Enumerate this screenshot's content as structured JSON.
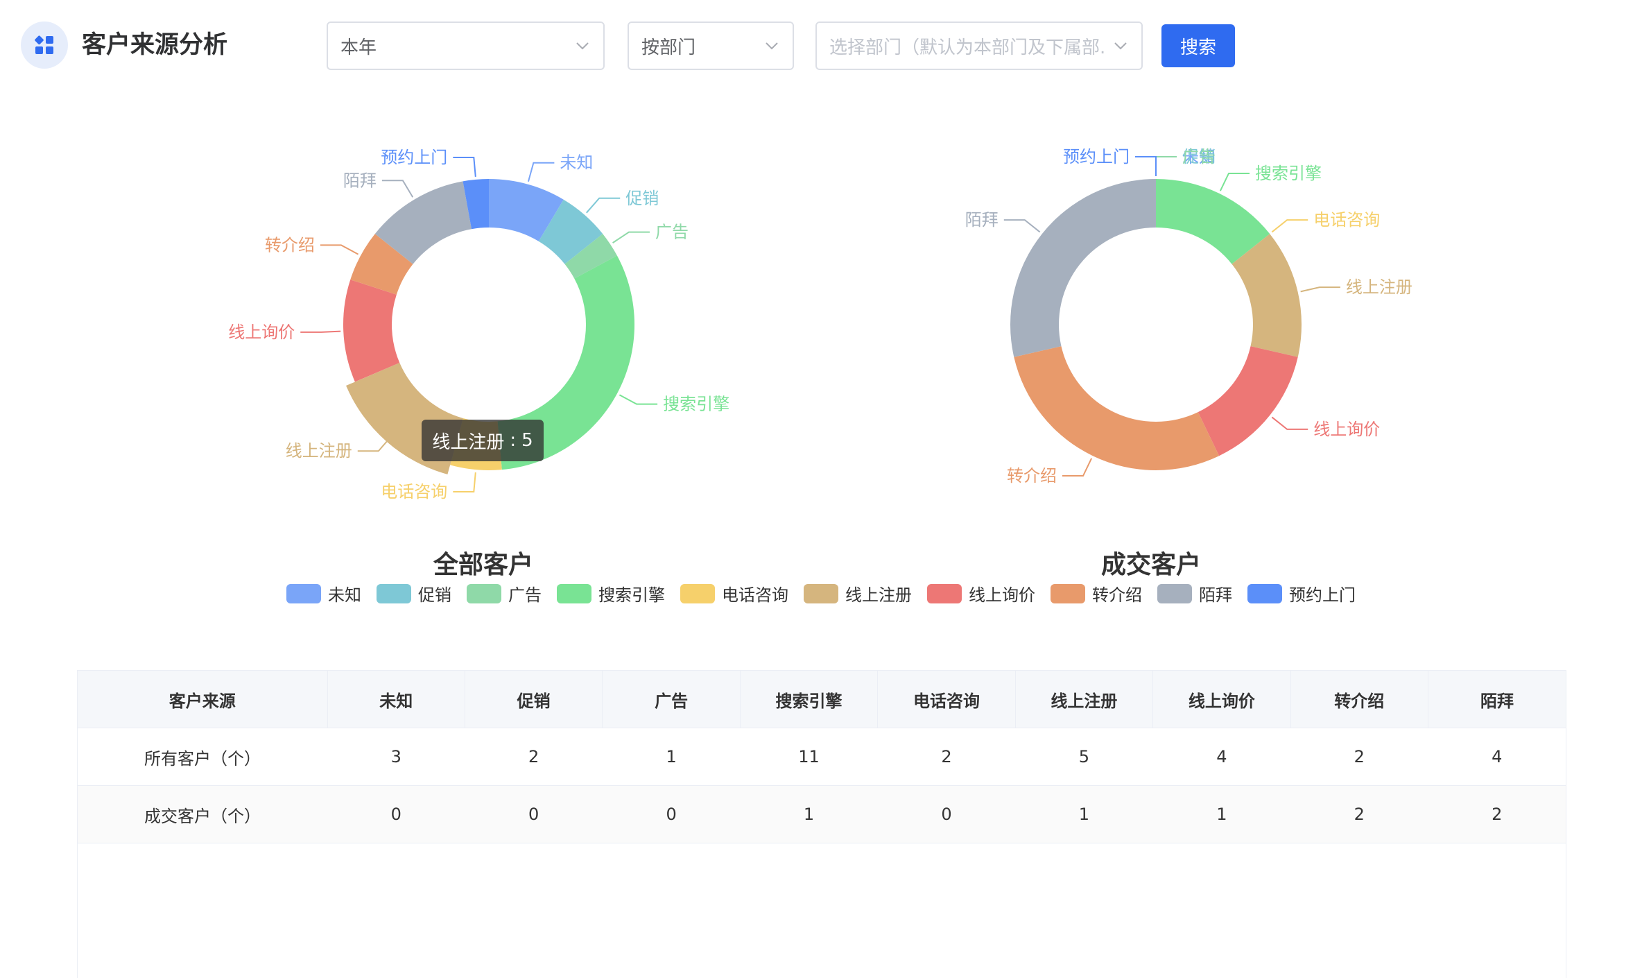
{
  "header": {
    "title": "客户来源分析",
    "period_value": "本年",
    "group_value": "按部门",
    "dept_placeholder": "选择部门（默认为本部门及下属部...",
    "search_label": "搜索"
  },
  "legend": [
    {
      "name": "未知",
      "color": "#7aa5f8"
    },
    {
      "name": "促销",
      "color": "#7ec8d6"
    },
    {
      "name": "广告",
      "color": "#8fd9a8"
    },
    {
      "name": "搜索引擎",
      "color": "#79e394"
    },
    {
      "name": "电话咨询",
      "color": "#f6d06b"
    },
    {
      "name": "线上注册",
      "color": "#d5b57e"
    },
    {
      "name": "线上询价",
      "color": "#ed7775"
    },
    {
      "name": "转介绍",
      "color": "#e89a6b"
    },
    {
      "name": "陌拜",
      "color": "#a6b0be"
    },
    {
      "name": "预约上门",
      "color": "#5b8ff9"
    }
  ],
  "chart_data": [
    {
      "type": "pie",
      "title": "全部客户",
      "categories": [
        "未知",
        "促销",
        "广告",
        "搜索引擎",
        "电话咨询",
        "线上注册",
        "线上询价",
        "转介绍",
        "陌拜",
        "预约上门"
      ],
      "values": [
        3,
        2,
        1,
        11,
        2,
        5,
        4,
        2,
        4,
        1
      ],
      "highlight": "线上注册"
    },
    {
      "type": "pie",
      "title": "成交客户",
      "categories": [
        "未知",
        "促销",
        "广告",
        "搜索引擎",
        "电话咨询",
        "线上注册",
        "线上询价",
        "转介绍",
        "陌拜",
        "预约上门"
      ],
      "values": [
        0,
        0,
        0,
        1,
        0,
        1,
        1,
        2,
        2,
        0
      ]
    }
  ],
  "tooltip": {
    "label": "线上注册",
    "sep": ":",
    "value": "5"
  },
  "table": {
    "headers": [
      "客户来源",
      "未知",
      "促销",
      "广告",
      "搜索引擎",
      "电话咨询",
      "线上注册",
      "线上询价",
      "转介绍",
      "陌拜"
    ],
    "rows": [
      [
        "所有客户（个）",
        "3",
        "2",
        "1",
        "11",
        "2",
        "5",
        "4",
        "2",
        "4"
      ],
      [
        "成交客户（个）",
        "0",
        "0",
        "0",
        "1",
        "0",
        "1",
        "1",
        "2",
        "2"
      ]
    ]
  }
}
